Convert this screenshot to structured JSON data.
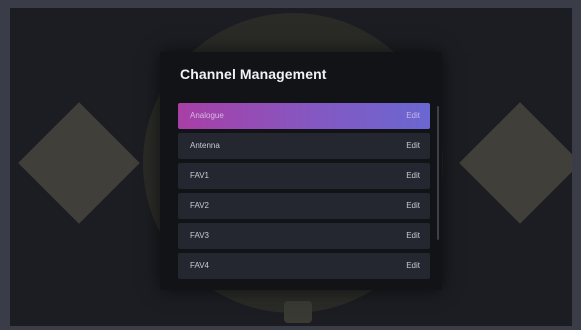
{
  "dialog": {
    "title": "Channel Management",
    "items": [
      {
        "name": "Analogue",
        "action": "Edit",
        "selected": true
      },
      {
        "name": "Antenna",
        "action": "Edit",
        "selected": false
      },
      {
        "name": "FAV1",
        "action": "Edit",
        "selected": false
      },
      {
        "name": "FAV2",
        "action": "Edit",
        "selected": false
      },
      {
        "name": "FAV3",
        "action": "Edit",
        "selected": false
      },
      {
        "name": "FAV4",
        "action": "Edit",
        "selected": false
      }
    ]
  },
  "colors": {
    "selected_gradient_start": "#a83fa6",
    "selected_gradient_end": "#6a67d1",
    "row_background": "#242630",
    "dialog_background": "#121317"
  }
}
